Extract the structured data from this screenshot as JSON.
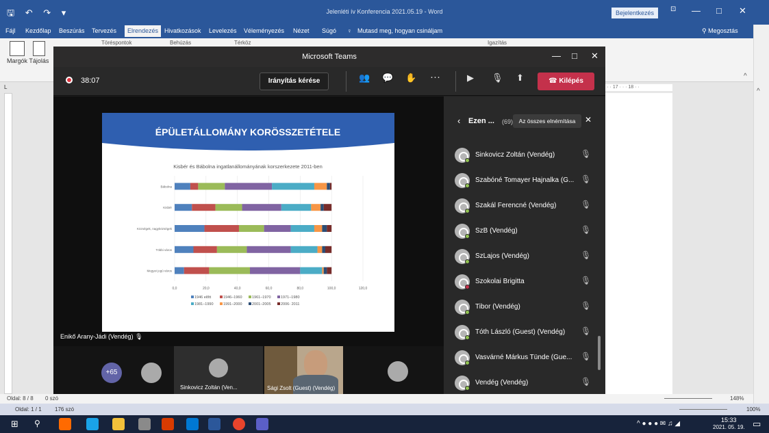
{
  "word": {
    "title": "Jelenléti ív Konferencia 2021.05.19  -  Word",
    "signin": "Bejelentkezés",
    "tabs": [
      "Fájl",
      "Kezdőlap",
      "Beszúrás",
      "Tervezés",
      "Elrendezés",
      "Hivatkozások",
      "Levelezés",
      "Véleményezés",
      "Nézet",
      "Súgó"
    ],
    "tell_me": "Mutasd meg, hogyan csináljam",
    "share": "Megosztás",
    "ribbon": {
      "margins": "Margók",
      "orientation": "Tájolás",
      "breaks": "Töréspontok",
      "indent": "Behúzás",
      "spacing": "Térköz",
      "align": "Igazítás"
    },
    "status1": {
      "page": "Oldal: 8 / 8",
      "words": "0 szó",
      "zoom": "148%"
    },
    "status2": {
      "page": "Oldal: 1 / 1",
      "words": "176 szó",
      "zoom": "100%"
    },
    "ruler_text": "· · · 17 · · · 18 · ·"
  },
  "taskbar": {
    "time": "15:33",
    "date": "2021. 05. 19."
  },
  "teams": {
    "window_title": "Microsoft Teams",
    "timer": "38:07",
    "request_control": "Irányítás kérése",
    "leave": "Kilépés",
    "presenter": "Enikő Arany-Jádi (Vendég)",
    "more_count": "+65",
    "strip_names": [
      "Sinkovicz Zoltán (Ven...",
      "Sági Zsolt (Guest) (Vendég)"
    ],
    "panel": {
      "title": "Ezen ...",
      "count": "(69)",
      "mute_all": "Az összes elnémítása",
      "participants": [
        "Sinkovicz Zoltán (Vendég)",
        "Szabóné Tomayer Hajnalka (G...",
        "Szakál Ferencné (Vendég)",
        "SzB (Vendég)",
        "SzLajos (Vendég)",
        "Szokolai Brigitta",
        "Tibor (Vendég)",
        "Tóth László (Guest) (Vendég)",
        "Vasvárné Márkus Tünde (Gue...",
        "Vendég (Vendég)"
      ],
      "dot_colors": [
        "#92c353",
        "#92c353",
        "#92c353",
        "#92c353",
        "#92c353",
        "#c4314b",
        "#92c353",
        "#92c353",
        "#92c353",
        "#92c353"
      ]
    },
    "slide": {
      "heading": "ÉPÜLETÁLLOMÁNY KORÖSSZETÉTELE"
    }
  },
  "chart_data": {
    "type": "bar",
    "orientation": "horizontal-stacked",
    "title": "Kisbér és Bábolna ingatlanállományának korszerkezete 2011-ben",
    "categories": [
      "Bábolna",
      "Kisbér",
      "Községek, nagyközségek",
      "Többi város",
      "Megyei jogú város"
    ],
    "xlim": [
      0,
      120
    ],
    "x_ticks": [
      "0,0",
      "20,0",
      "40,0",
      "60,0",
      "80,0",
      "100,0",
      "120,0"
    ],
    "series": [
      {
        "name": "1946 előtt",
        "color": "#4f81bd",
        "values": [
          10,
          11,
          19,
          12,
          6
        ]
      },
      {
        "name": "1946–1960",
        "color": "#c0504d",
        "values": [
          5,
          15,
          22,
          15,
          16
        ]
      },
      {
        "name": "1961–1970",
        "color": "#9bbb59",
        "values": [
          17,
          17,
          16,
          19,
          26
        ]
      },
      {
        "name": "1971–1980",
        "color": "#8064a2",
        "values": [
          30,
          25,
          17,
          28,
          32
        ]
      },
      {
        "name": "1981–1990",
        "color": "#4bacc6",
        "values": [
          27,
          19,
          15,
          17,
          14
        ]
      },
      {
        "name": "1991–2000",
        "color": "#f79646",
        "values": [
          8,
          6,
          5,
          3,
          1
        ]
      },
      {
        "name": "2001–2005",
        "color": "#2c4d75",
        "values": [
          2,
          2,
          3,
          2,
          2
        ]
      },
      {
        "name": "2006- 2011",
        "color": "#772c2a",
        "values": [
          1,
          5,
          3,
          4,
          3
        ]
      }
    ],
    "legend": "bottom"
  }
}
